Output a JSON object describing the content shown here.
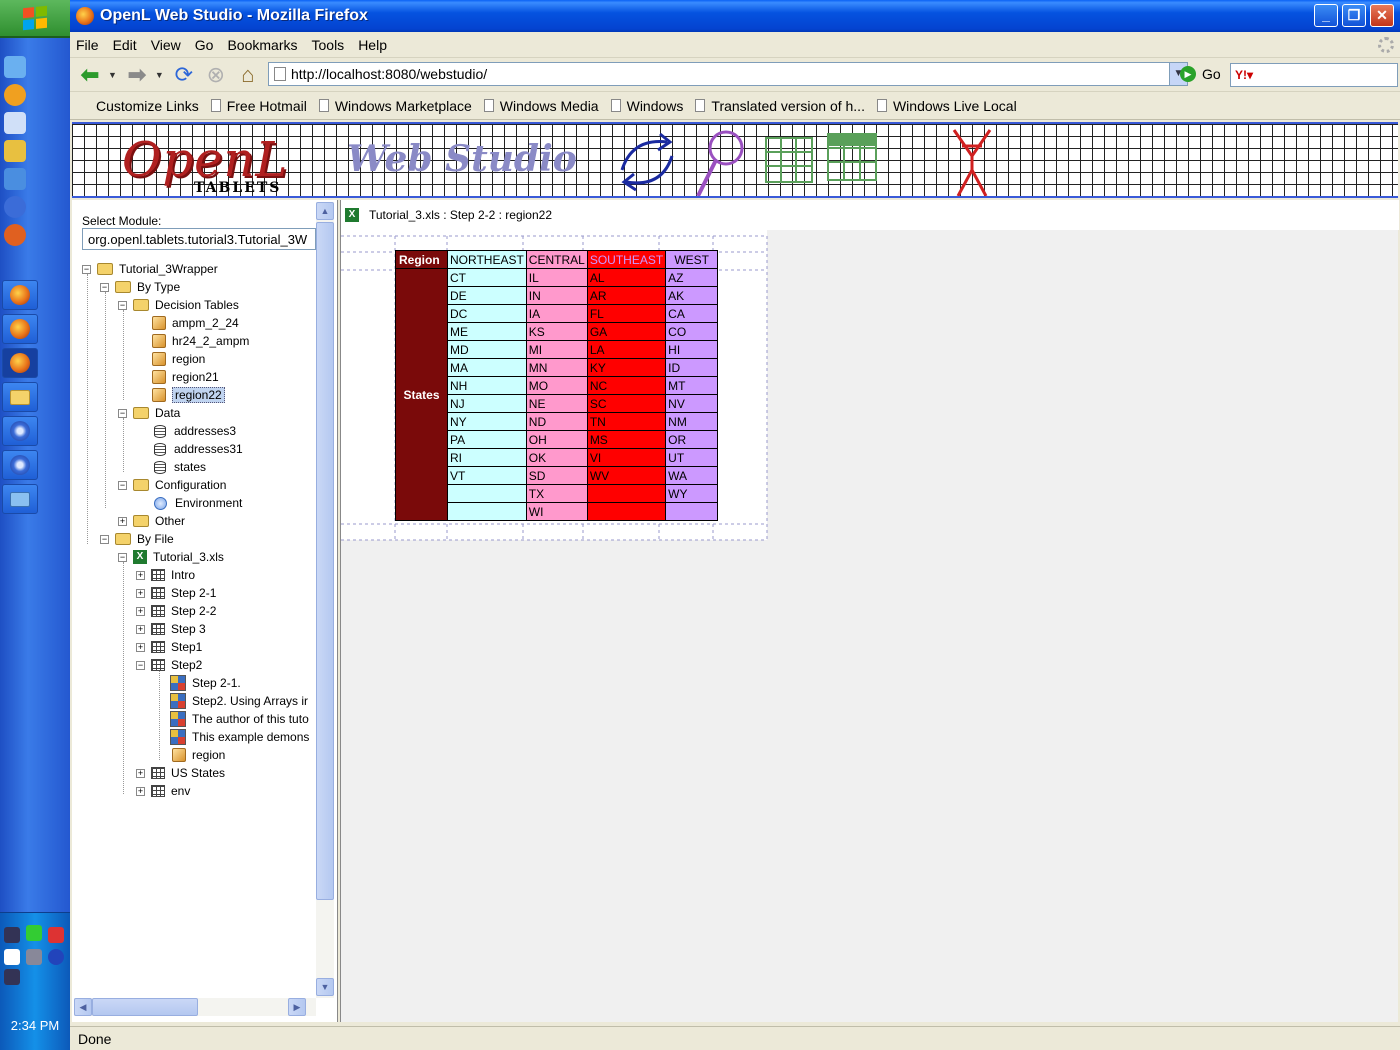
{
  "taskbar": {
    "clock": "2:34 PM"
  },
  "window": {
    "title": "OpenL Web Studio - Mozilla Firefox"
  },
  "menu": [
    "File",
    "Edit",
    "View",
    "Go",
    "Bookmarks",
    "Tools",
    "Help"
  ],
  "navigation": {
    "url": "http://localhost:8080/webstudio/",
    "go_label": "Go"
  },
  "bookmarks": [
    "Customize Links",
    "Free Hotmail",
    "Windows Marketplace",
    "Windows Media",
    "Windows",
    "Translated version of h...",
    "Windows Live Local"
  ],
  "banner": {
    "logo_main": "OpenL",
    "logo_sub": "TABLETS",
    "logo_studio": "Web Studio"
  },
  "left_panel": {
    "select_label": "Select Module:",
    "module_value": "org.openl.tablets.tutorial3.Tutorial_3W",
    "tree": {
      "root": "Tutorial_3Wrapper",
      "by_type": "By Type",
      "decision_tables": "Decision Tables",
      "dt_items": [
        "ampm_2_24",
        "hr24_2_ampm",
        "region",
        "region21",
        "region22"
      ],
      "data": "Data",
      "data_items": [
        "addresses3",
        "addresses31",
        "states"
      ],
      "configuration": "Configuration",
      "environment": "Environment",
      "other": "Other",
      "by_file": "By File",
      "file": "Tutorial_3.xls",
      "sheets": [
        "Intro",
        "Step 2-1",
        "Step 2-2",
        "Step 3",
        "Step1",
        "Step2"
      ],
      "step2_items": [
        "Step 2-1.",
        "Step2. Using Arrays ir",
        "The author of this tuto",
        "This example demons"
      ],
      "step2_region": "region",
      "more_sheets": [
        "US States",
        "env"
      ]
    }
  },
  "content": {
    "breadcrumb": "Tutorial_3.xls : Step 2-2 : region22",
    "table": {
      "corner": "Region",
      "row_label": "States",
      "headers": [
        "NORTHEAST",
        "CENTRAL",
        "SOUTHEAST",
        "WEST"
      ],
      "rows": [
        [
          "CT",
          "IL",
          "AL",
          "AZ"
        ],
        [
          "DE",
          "IN",
          "AR",
          "AK"
        ],
        [
          "DC",
          "IA",
          "FL",
          "CA"
        ],
        [
          "ME",
          "KS",
          "GA",
          "CO"
        ],
        [
          "MD",
          "MI",
          "LA",
          "HI"
        ],
        [
          "MA",
          "MN",
          "KY",
          "ID"
        ],
        [
          "NH",
          "MO",
          "NC",
          "MT"
        ],
        [
          "NJ",
          "NE",
          "SC",
          "NV"
        ],
        [
          "NY",
          "ND",
          "TN",
          "NM"
        ],
        [
          "PA",
          "OH",
          "MS",
          "OR"
        ],
        [
          "RI",
          "OK",
          "VI",
          "UT"
        ],
        [
          "VT",
          "SD",
          "WV",
          "WA"
        ],
        [
          "",
          "TX",
          "",
          "WY"
        ],
        [
          "",
          "WI",
          "",
          ""
        ]
      ]
    }
  },
  "status": {
    "text": "Done"
  }
}
